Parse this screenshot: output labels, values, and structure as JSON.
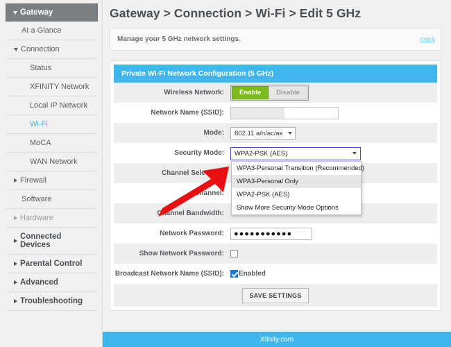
{
  "sidebar": {
    "header": {
      "label": "Gateway",
      "caret": "caret-down-icon"
    },
    "items": [
      {
        "label": "At a Glance",
        "level": 1,
        "caret": "none",
        "state": "normal"
      },
      {
        "label": "Connection",
        "level": 1,
        "caret": "caret-down",
        "state": "normal"
      },
      {
        "label": "Status",
        "level": 2,
        "caret": "none",
        "state": "normal"
      },
      {
        "label": "XFINITY Network",
        "level": 2,
        "caret": "none",
        "state": "normal"
      },
      {
        "label": "Local IP Network",
        "level": 2,
        "caret": "none",
        "state": "normal"
      },
      {
        "label": "Wi-Fi",
        "level": 2,
        "caret": "none",
        "state": "active"
      },
      {
        "label": "MoCA",
        "level": 2,
        "caret": "none",
        "state": "normal"
      },
      {
        "label": "WAN Network",
        "level": 2,
        "caret": "none",
        "state": "normal"
      },
      {
        "label": "Firewall",
        "level": 1,
        "caret": "caret-right",
        "state": "normal"
      },
      {
        "label": "Software",
        "level": 1,
        "caret": "none",
        "state": "normal"
      },
      {
        "label": "Hardware",
        "level": 1,
        "caret": "caret-right",
        "state": "muted"
      },
      {
        "label": "Connected Devices",
        "level": 0,
        "caret": "caret-right",
        "state": "top"
      },
      {
        "label": "Parental Control",
        "level": 0,
        "caret": "caret-right",
        "state": "top"
      },
      {
        "label": "Advanced",
        "level": 0,
        "caret": "caret-right",
        "state": "top"
      },
      {
        "label": "Troubleshooting",
        "level": 0,
        "caret": "caret-right",
        "state": "top"
      }
    ]
  },
  "main": {
    "breadcrumb": "Gateway > Connection > Wi-Fi > Edit 5 GHz",
    "info": {
      "text": "Manage your 5 GHz network settings.",
      "more_label": "more"
    },
    "panel_title": "Private Wi-Fi Network Configuration (5 GHz)",
    "fields": {
      "wireless_network": {
        "label": "Wireless Network:",
        "enable_label": "Enable",
        "disable_label": "Disable",
        "selected": "Enable"
      },
      "ssid": {
        "label": "Network Name (SSID):",
        "value": "",
        "placeholder": ""
      },
      "mode": {
        "label": "Mode:",
        "value": "802.11 a/n/ac/ax"
      },
      "security_mode": {
        "label": "Security Mode:",
        "value": "WPA2-PSK (AES)",
        "open": true,
        "highlighted_index": 1,
        "options": [
          "WPA3-Personal Transition (Recommended)",
          "WPA3-Personal Only",
          "WPA2-PSK (AES)",
          "Show More Security Mode Options"
        ]
      },
      "channel_selection": {
        "label": "Channel Selection:"
      },
      "channel": {
        "label": "Channel:"
      },
      "channel_bandwidth": {
        "label": "Channel Bandwidth:"
      },
      "network_password": {
        "label": "Network Password:",
        "value": "●●●●●●●●●●●"
      },
      "show_network_password": {
        "label": "Show Network Password:",
        "checked": false
      },
      "broadcast_ssid": {
        "label": "Broadcast Network Name (SSID):",
        "checked": true,
        "value_label": "Enabled"
      }
    },
    "save_button": "SAVE SETTINGS"
  },
  "footer": {
    "label": "Xfinity.com"
  },
  "annotation": {
    "arrow_color": "#e81010"
  },
  "colors": {
    "accent": "#3fb7ec",
    "panel_header": "#3fb7ec",
    "enable_green": "#7cbb1e",
    "sidebar_header": "#7a7f84",
    "checkbox_blue": "#1677e0"
  }
}
